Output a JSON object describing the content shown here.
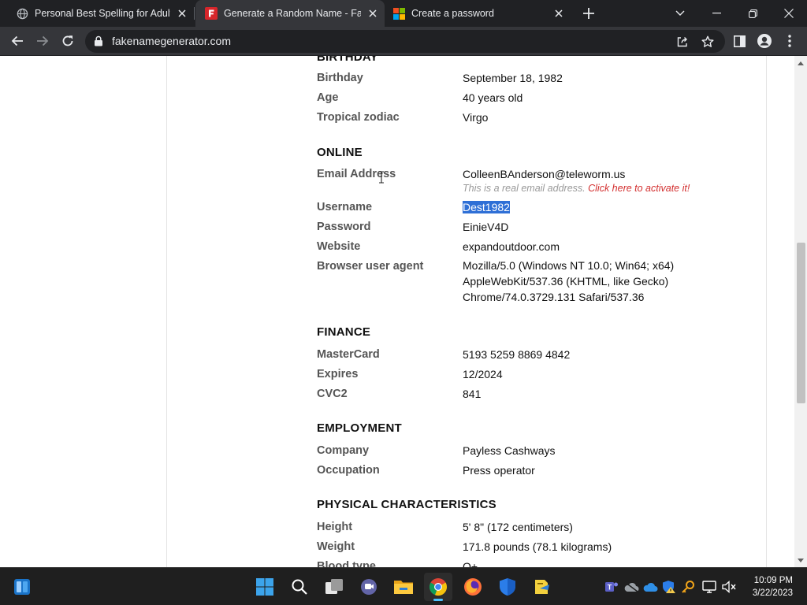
{
  "browser": {
    "tabs": [
      {
        "title": "Personal Best Spelling for Adults,",
        "favicon": "globe-icon"
      },
      {
        "title": "Generate a Random Name - Fake",
        "favicon": "fakename-logo-icon",
        "active": true
      },
      {
        "title": "Create a password",
        "favicon": "microsoft-logo-icon"
      }
    ],
    "url": "fakenamegenerator.com"
  },
  "page": {
    "birthday_heading": "BIRTHDAY",
    "birthday": [
      {
        "label": "Birthday",
        "value": "September 18, 1982"
      },
      {
        "label": "Age",
        "value": "40 years old"
      },
      {
        "label": "Tropical zodiac",
        "value": "Virgo"
      }
    ],
    "online_heading": "ONLINE",
    "email": {
      "label": "Email Address",
      "value": "ColleenBAnderson@teleworm.us",
      "note": "This is a real email address.",
      "activate_link": "Click here to activate it!"
    },
    "username": {
      "label": "Username",
      "value": "Dest1982"
    },
    "password": {
      "label": "Password",
      "value": "EinieV4D"
    },
    "website": {
      "label": "Website",
      "value": "expandoutdoor.com"
    },
    "user_agent": {
      "label": "Browser user agent",
      "lines": [
        "Mozilla/5.0 (Windows NT 10.0; Win64; x64)",
        "AppleWebKit/537.36 (KHTML, like Gecko)",
        "Chrome/74.0.3729.131 Safari/537.36"
      ]
    },
    "finance_heading": "FINANCE",
    "finance": [
      {
        "label": "MasterCard",
        "value": "5193 5259 8869 4842"
      },
      {
        "label": "Expires",
        "value": "12/2024"
      },
      {
        "label": "CVC2",
        "value": "841"
      }
    ],
    "employment_heading": "EMPLOYMENT",
    "employment": [
      {
        "label": "Company",
        "value": "Payless Cashways"
      },
      {
        "label": "Occupation",
        "value": "Press operator"
      }
    ],
    "physical_heading": "PHYSICAL CHARACTERISTICS",
    "physical": [
      {
        "label": "Height",
        "value": "5' 8\" (172 centimeters)"
      },
      {
        "label": "Weight",
        "value": "171.8 pounds (78.1 kilograms)"
      },
      {
        "label": "Blood type",
        "value": "O+"
      }
    ]
  },
  "taskbar": {
    "apps": [
      "widgets-icon",
      "start-icon",
      "search-icon",
      "task-view-icon",
      "teams-chat-icon",
      "file-explorer-icon",
      "chrome-icon",
      "firefox-icon",
      "defender-icon",
      "notes-app-icon"
    ],
    "active_app": "chrome-icon",
    "time": "10:09 PM",
    "date": "3/22/2023"
  },
  "colors": {
    "selection": "#2e6fd6",
    "activate_link": "#d32f2f",
    "taskbar_indicator": "#4cc2ff"
  }
}
